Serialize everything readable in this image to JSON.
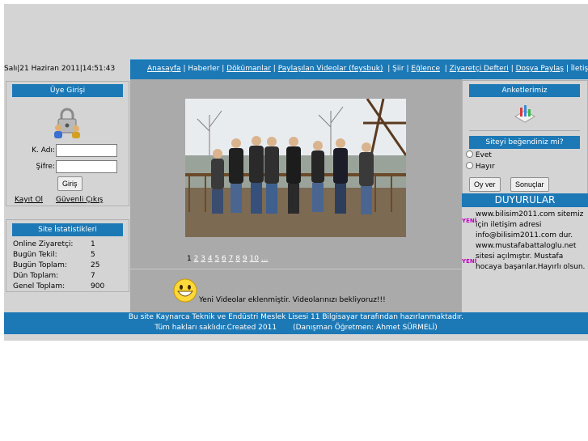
{
  "date_line": "Salı|21 Haziran 2011|14:51:43",
  "nav": {
    "items": [
      "Anasayfa",
      "Haberler",
      "Dökümanlar",
      "Paylaşılan Videolar (feysbuk)",
      "Şiir",
      "Eğlence",
      "Ziyaretçi Defteri",
      "Dosya Paylaş",
      "İletişim"
    ]
  },
  "login": {
    "title": "Üye Girişi",
    "username_label": "K. Adı:",
    "password_label": "Şifre:",
    "login_button": "Giriş",
    "register_link": "Kayıt Ol",
    "logout_link": "Güvenli Çıkış"
  },
  "stats": {
    "title": "Site İstatistikleri",
    "rows": [
      {
        "label": "Online Ziyaretçi:",
        "value": "1"
      },
      {
        "label": "Bugün Tekil:",
        "value": "5"
      },
      {
        "label": "Bugün Toplam:",
        "value": "25"
      },
      {
        "label": "Dün Toplam:",
        "value": "7"
      },
      {
        "label": "Genel Toplam:",
        "value": "900"
      }
    ]
  },
  "gallery": {
    "pages_current": "1",
    "pages": [
      "2",
      "3",
      "4",
      "5",
      "6",
      "7",
      "8",
      "9",
      "10",
      "..."
    ]
  },
  "announcement": "Yeni Videolar eklenmiştir. Videolarınızı bekliyoruz!!!",
  "poll": {
    "surveys_title": "Anketlerimiz",
    "question_title": "Siteyi beğendiniz mi?",
    "options": [
      "Evet",
      "Hayır"
    ],
    "vote_button": "Oy ver",
    "results_button": "Sonuçlar"
  },
  "news": {
    "title": "DUYURULAR",
    "badge": "YENİ",
    "items": [
      "www.bilisim2011.com sitemiz için iletişim adresi info@bilisim2011.com dur.",
      "www.mustafabattaloglu.net sitesi açılmıştır. Mustafa hocaya başarılar.Hayırlı olsun."
    ]
  },
  "footer": {
    "line1": "Bu site Kaynarca Teknik ve Endüstri Meslek Lisesi 11 Bilgisayar tarafından hazırlanmaktadır.",
    "line2": "Tüm hakları saklıdır.Created 2011       (Danışman Öğretmen: Ahmet SÜRMELİ)"
  },
  "colors": {
    "accent": "#1c79b6",
    "panel": "#d4d4d4",
    "content": "#aaaaaa"
  }
}
